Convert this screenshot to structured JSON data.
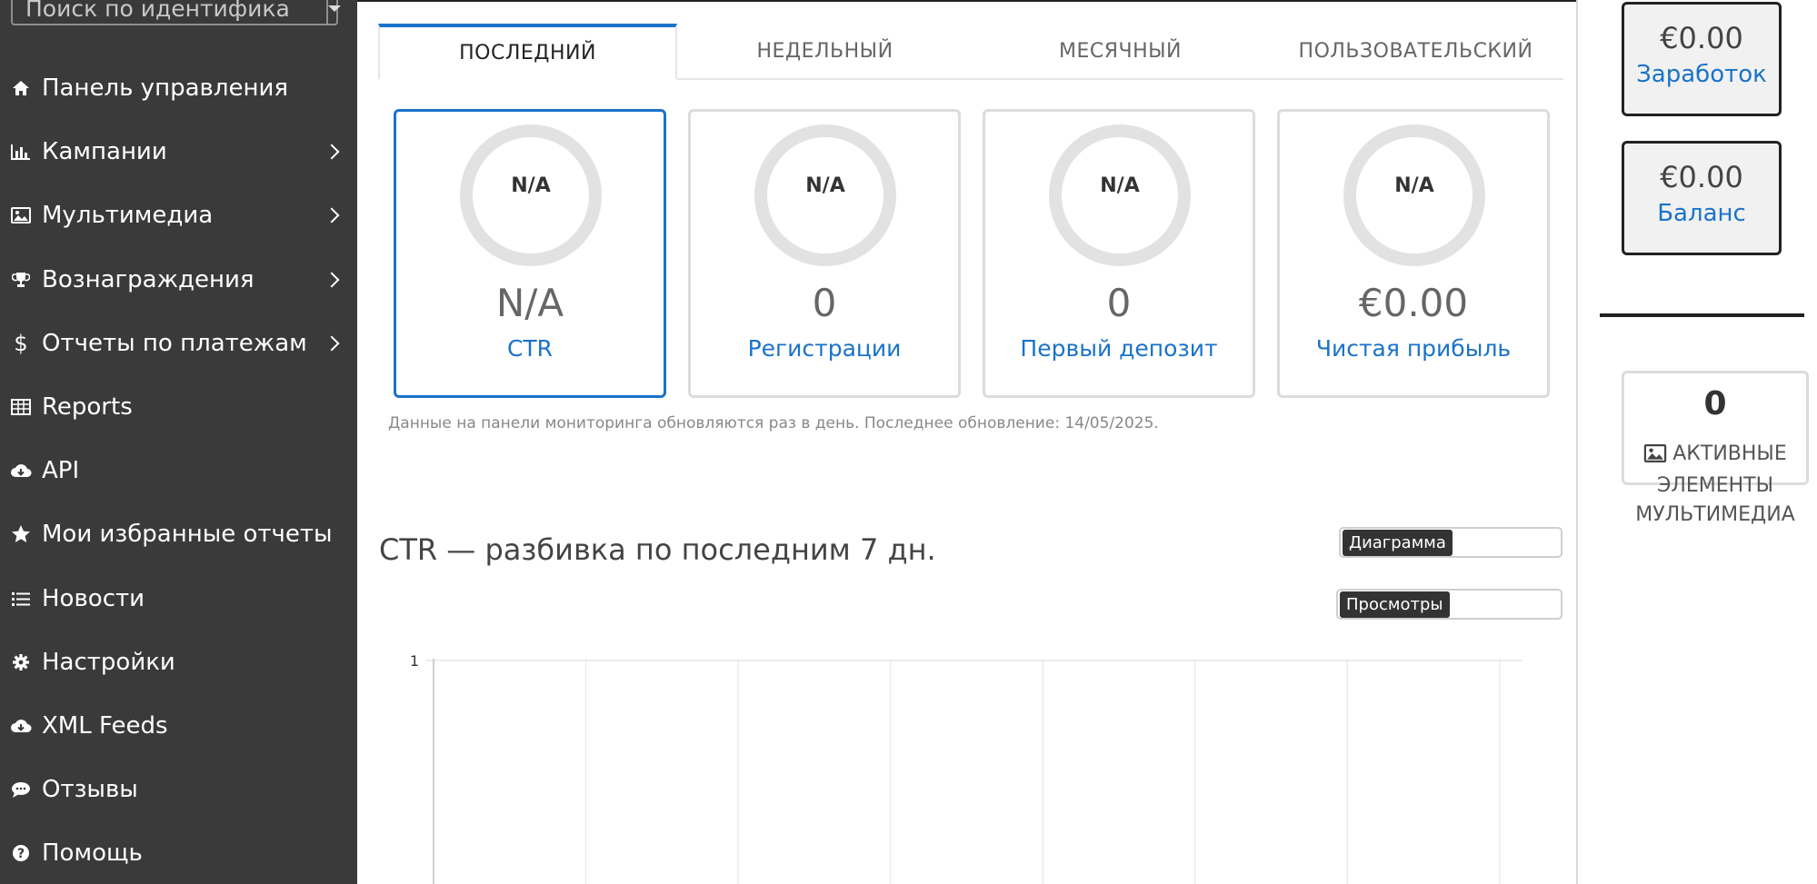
{
  "search": {
    "placeholder": "Поиск по идентифика"
  },
  "sidebar": {
    "items": [
      {
        "label": "Панель управления",
        "icon": "home-icon",
        "has_submenu": false
      },
      {
        "label": "Кампании",
        "icon": "bar-chart-icon",
        "has_submenu": true
      },
      {
        "label": "Мультимедиа",
        "icon": "image-icon",
        "has_submenu": true
      },
      {
        "label": "Вознаграждения",
        "icon": "trophy-icon",
        "has_submenu": true
      },
      {
        "label": "Отчеты по платежам",
        "icon": "dollar-icon",
        "has_submenu": true
      },
      {
        "label": "Reports",
        "icon": "table-icon",
        "has_submenu": false
      },
      {
        "label": "API",
        "icon": "cloud-icon",
        "has_submenu": false
      },
      {
        "label": "Мои избранные отчеты",
        "icon": "star-icon",
        "has_submenu": false
      },
      {
        "label": "Новости",
        "icon": "list-icon",
        "has_submenu": false
      },
      {
        "label": "Настройки",
        "icon": "gear-icon",
        "has_submenu": false
      },
      {
        "label": "XML Feeds",
        "icon": "cloud-icon",
        "has_submenu": false
      },
      {
        "label": "Отзывы",
        "icon": "comment-icon",
        "has_submenu": false
      },
      {
        "label": "Помощь",
        "icon": "question-icon",
        "has_submenu": false
      }
    ]
  },
  "tabs": [
    {
      "label": "ПОСЛЕДНИЙ",
      "active": true
    },
    {
      "label": "НЕДЕЛЬНЫЙ",
      "active": false
    },
    {
      "label": "МЕСЯЧНЫЙ",
      "active": false
    },
    {
      "label": "ПОЛЬЗОВАТЕЛЬСКИЙ",
      "active": false
    }
  ],
  "cards": [
    {
      "ring": "N/A",
      "value": "N/A",
      "label": "CTR",
      "active": true
    },
    {
      "ring": "N/A",
      "value": "0",
      "label": "Регистрации",
      "active": false
    },
    {
      "ring": "N/A",
      "value": "0",
      "label": "Первый депозит",
      "active": false
    },
    {
      "ring": "N/A",
      "value": "€0.00",
      "label": "Чистая прибыль",
      "active": false
    }
  ],
  "note": "Данные на панели мониторинга обновляются раз в день. Последнее обновление: 14/05/2025.",
  "chart_section": {
    "title": "CTR — разбивка по последним 7 дн.",
    "selector_chart": "Диаграмма",
    "selector_metric": "Просмотры"
  },
  "chart_data": {
    "type": "line",
    "title": "CTR — разбивка по последним 7 дн.",
    "y_tick_labels": [
      "1"
    ],
    "x_categories_visible": 7,
    "series": []
  },
  "right": {
    "earnings": {
      "amount": "€0.00",
      "label": "Заработок"
    },
    "balance": {
      "amount": "€0.00",
      "label": "Баланс"
    },
    "media": {
      "count": "0",
      "label": "АКТИВНЫЕ ЭЛЕМЕНТЫ МУЛЬТИМЕДИА"
    }
  },
  "colors": {
    "accent": "#1a73c9",
    "sidebar_bg": "#3a3a3a",
    "ring": "#e2e2e2"
  }
}
